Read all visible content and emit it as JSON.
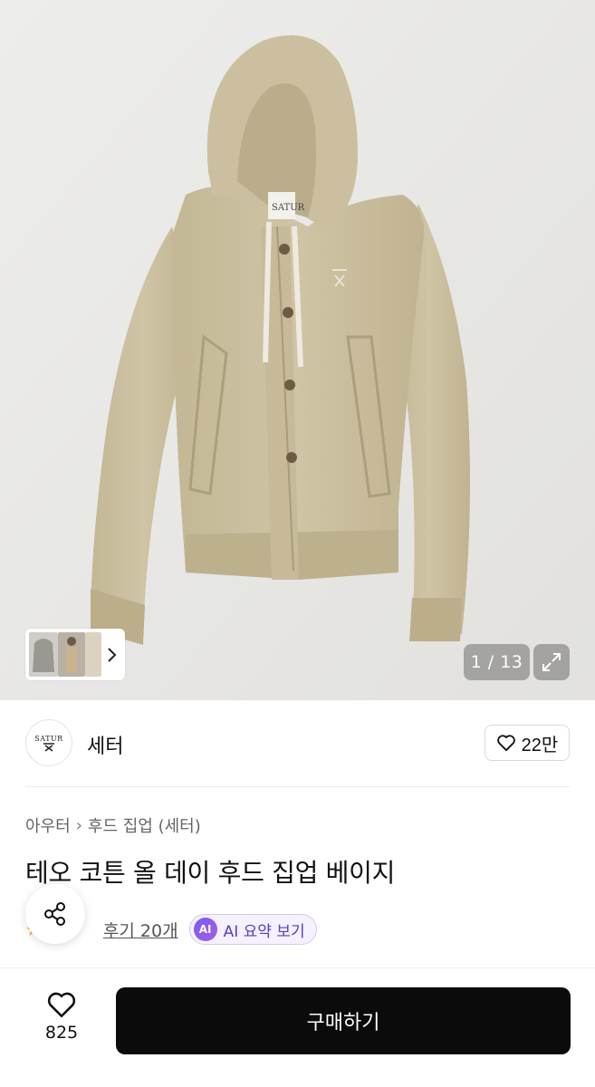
{
  "gallery": {
    "counter": "1 / 13",
    "logo_text": "SATUR"
  },
  "brand": {
    "logo_text": "SATUR",
    "name": "세터",
    "favorite_count": "22만"
  },
  "product": {
    "breadcrumb": [
      "아우터",
      "후드 집업 (세터)"
    ],
    "title": "테오 코튼 올 데이 후드 집업 베이지",
    "review_label": "후기 20개",
    "ai_badge": "AI",
    "ai_summary_label": "AI 요약 보기"
  },
  "bottom_bar": {
    "like_count": "825",
    "buy_label": "구매하기"
  },
  "colors": {
    "buy_button": "#0b0b0b",
    "ai_accent": "#5b3bc7",
    "star": "#f5b324",
    "garment": "#cbbf9f"
  },
  "icons": [
    "chevron-right-icon",
    "expand-icon",
    "heart-outline-icon",
    "share-icon",
    "star-icon"
  ]
}
